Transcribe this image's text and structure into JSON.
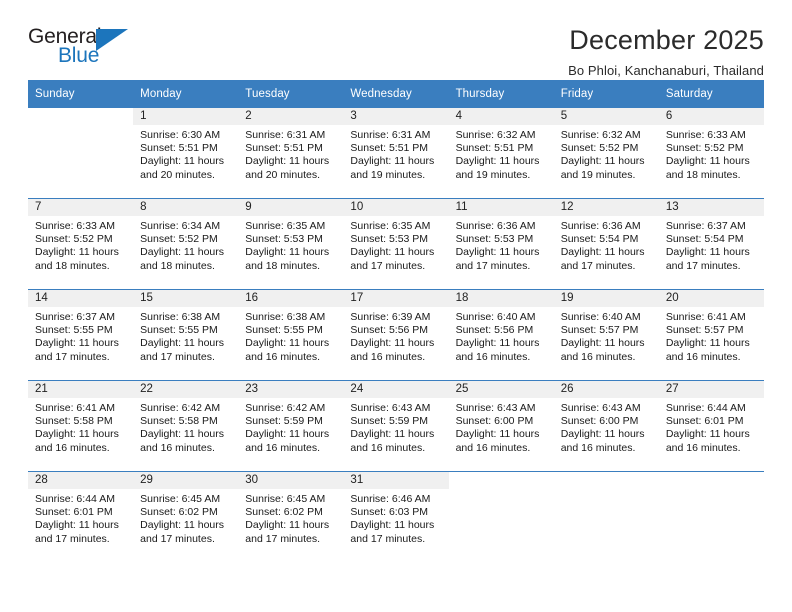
{
  "brand": {
    "name_dark": "General",
    "name_blue": "Blue",
    "accent_color": "#1c75bc"
  },
  "header": {
    "title": "December 2025",
    "subtitle": "Bo Phloi, Kanchanaburi, Thailand"
  },
  "theme": {
    "header_row_bg": "#3a7ebf",
    "daynum_band_bg": "#f0f0f0",
    "text_color": "#1a1a1a"
  },
  "labels": {
    "sunrise_prefix": "Sunrise:",
    "sunset_prefix": "Sunset:",
    "daylight_prefix": "Daylight:"
  },
  "weekday_headers": [
    "Sunday",
    "Monday",
    "Tuesday",
    "Wednesday",
    "Thursday",
    "Friday",
    "Saturday"
  ],
  "weeks": [
    [
      {
        "day": "",
        "sunrise": "",
        "sunset": "",
        "daylight_line1": "",
        "daylight_line2": "",
        "blank": true
      },
      {
        "day": "1",
        "sunrise": "Sunrise: 6:30 AM",
        "sunset": "Sunset: 5:51 PM",
        "daylight_line1": "Daylight: 11 hours",
        "daylight_line2": "and 20 minutes."
      },
      {
        "day": "2",
        "sunrise": "Sunrise: 6:31 AM",
        "sunset": "Sunset: 5:51 PM",
        "daylight_line1": "Daylight: 11 hours",
        "daylight_line2": "and 20 minutes."
      },
      {
        "day": "3",
        "sunrise": "Sunrise: 6:31 AM",
        "sunset": "Sunset: 5:51 PM",
        "daylight_line1": "Daylight: 11 hours",
        "daylight_line2": "and 19 minutes."
      },
      {
        "day": "4",
        "sunrise": "Sunrise: 6:32 AM",
        "sunset": "Sunset: 5:51 PM",
        "daylight_line1": "Daylight: 11 hours",
        "daylight_line2": "and 19 minutes."
      },
      {
        "day": "5",
        "sunrise": "Sunrise: 6:32 AM",
        "sunset": "Sunset: 5:52 PM",
        "daylight_line1": "Daylight: 11 hours",
        "daylight_line2": "and 19 minutes."
      },
      {
        "day": "6",
        "sunrise": "Sunrise: 6:33 AM",
        "sunset": "Sunset: 5:52 PM",
        "daylight_line1": "Daylight: 11 hours",
        "daylight_line2": "and 18 minutes."
      }
    ],
    [
      {
        "day": "7",
        "sunrise": "Sunrise: 6:33 AM",
        "sunset": "Sunset: 5:52 PM",
        "daylight_line1": "Daylight: 11 hours",
        "daylight_line2": "and 18 minutes."
      },
      {
        "day": "8",
        "sunrise": "Sunrise: 6:34 AM",
        "sunset": "Sunset: 5:52 PM",
        "daylight_line1": "Daylight: 11 hours",
        "daylight_line2": "and 18 minutes."
      },
      {
        "day": "9",
        "sunrise": "Sunrise: 6:35 AM",
        "sunset": "Sunset: 5:53 PM",
        "daylight_line1": "Daylight: 11 hours",
        "daylight_line2": "and 18 minutes."
      },
      {
        "day": "10",
        "sunrise": "Sunrise: 6:35 AM",
        "sunset": "Sunset: 5:53 PM",
        "daylight_line1": "Daylight: 11 hours",
        "daylight_line2": "and 17 minutes."
      },
      {
        "day": "11",
        "sunrise": "Sunrise: 6:36 AM",
        "sunset": "Sunset: 5:53 PM",
        "daylight_line1": "Daylight: 11 hours",
        "daylight_line2": "and 17 minutes."
      },
      {
        "day": "12",
        "sunrise": "Sunrise: 6:36 AM",
        "sunset": "Sunset: 5:54 PM",
        "daylight_line1": "Daylight: 11 hours",
        "daylight_line2": "and 17 minutes."
      },
      {
        "day": "13",
        "sunrise": "Sunrise: 6:37 AM",
        "sunset": "Sunset: 5:54 PM",
        "daylight_line1": "Daylight: 11 hours",
        "daylight_line2": "and 17 minutes."
      }
    ],
    [
      {
        "day": "14",
        "sunrise": "Sunrise: 6:37 AM",
        "sunset": "Sunset: 5:55 PM",
        "daylight_line1": "Daylight: 11 hours",
        "daylight_line2": "and 17 minutes."
      },
      {
        "day": "15",
        "sunrise": "Sunrise: 6:38 AM",
        "sunset": "Sunset: 5:55 PM",
        "daylight_line1": "Daylight: 11 hours",
        "daylight_line2": "and 17 minutes."
      },
      {
        "day": "16",
        "sunrise": "Sunrise: 6:38 AM",
        "sunset": "Sunset: 5:55 PM",
        "daylight_line1": "Daylight: 11 hours",
        "daylight_line2": "and 16 minutes."
      },
      {
        "day": "17",
        "sunrise": "Sunrise: 6:39 AM",
        "sunset": "Sunset: 5:56 PM",
        "daylight_line1": "Daylight: 11 hours",
        "daylight_line2": "and 16 minutes."
      },
      {
        "day": "18",
        "sunrise": "Sunrise: 6:40 AM",
        "sunset": "Sunset: 5:56 PM",
        "daylight_line1": "Daylight: 11 hours",
        "daylight_line2": "and 16 minutes."
      },
      {
        "day": "19",
        "sunrise": "Sunrise: 6:40 AM",
        "sunset": "Sunset: 5:57 PM",
        "daylight_line1": "Daylight: 11 hours",
        "daylight_line2": "and 16 minutes."
      },
      {
        "day": "20",
        "sunrise": "Sunrise: 6:41 AM",
        "sunset": "Sunset: 5:57 PM",
        "daylight_line1": "Daylight: 11 hours",
        "daylight_line2": "and 16 minutes."
      }
    ],
    [
      {
        "day": "21",
        "sunrise": "Sunrise: 6:41 AM",
        "sunset": "Sunset: 5:58 PM",
        "daylight_line1": "Daylight: 11 hours",
        "daylight_line2": "and 16 minutes."
      },
      {
        "day": "22",
        "sunrise": "Sunrise: 6:42 AM",
        "sunset": "Sunset: 5:58 PM",
        "daylight_line1": "Daylight: 11 hours",
        "daylight_line2": "and 16 minutes."
      },
      {
        "day": "23",
        "sunrise": "Sunrise: 6:42 AM",
        "sunset": "Sunset: 5:59 PM",
        "daylight_line1": "Daylight: 11 hours",
        "daylight_line2": "and 16 minutes."
      },
      {
        "day": "24",
        "sunrise": "Sunrise: 6:43 AM",
        "sunset": "Sunset: 5:59 PM",
        "daylight_line1": "Daylight: 11 hours",
        "daylight_line2": "and 16 minutes."
      },
      {
        "day": "25",
        "sunrise": "Sunrise: 6:43 AM",
        "sunset": "Sunset: 6:00 PM",
        "daylight_line1": "Daylight: 11 hours",
        "daylight_line2": "and 16 minutes."
      },
      {
        "day": "26",
        "sunrise": "Sunrise: 6:43 AM",
        "sunset": "Sunset: 6:00 PM",
        "daylight_line1": "Daylight: 11 hours",
        "daylight_line2": "and 16 minutes."
      },
      {
        "day": "27",
        "sunrise": "Sunrise: 6:44 AM",
        "sunset": "Sunset: 6:01 PM",
        "daylight_line1": "Daylight: 11 hours",
        "daylight_line2": "and 16 minutes."
      }
    ],
    [
      {
        "day": "28",
        "sunrise": "Sunrise: 6:44 AM",
        "sunset": "Sunset: 6:01 PM",
        "daylight_line1": "Daylight: 11 hours",
        "daylight_line2": "and 17 minutes."
      },
      {
        "day": "29",
        "sunrise": "Sunrise: 6:45 AM",
        "sunset": "Sunset: 6:02 PM",
        "daylight_line1": "Daylight: 11 hours",
        "daylight_line2": "and 17 minutes."
      },
      {
        "day": "30",
        "sunrise": "Sunrise: 6:45 AM",
        "sunset": "Sunset: 6:02 PM",
        "daylight_line1": "Daylight: 11 hours",
        "daylight_line2": "and 17 minutes."
      },
      {
        "day": "31",
        "sunrise": "Sunrise: 6:46 AM",
        "sunset": "Sunset: 6:03 PM",
        "daylight_line1": "Daylight: 11 hours",
        "daylight_line2": "and 17 minutes."
      },
      {
        "day": "",
        "sunrise": "",
        "sunset": "",
        "daylight_line1": "",
        "daylight_line2": "",
        "blank": true
      },
      {
        "day": "",
        "sunrise": "",
        "sunset": "",
        "daylight_line1": "",
        "daylight_line2": "",
        "blank": true
      },
      {
        "day": "",
        "sunrise": "",
        "sunset": "",
        "daylight_line1": "",
        "daylight_line2": "",
        "blank": true
      }
    ]
  ]
}
